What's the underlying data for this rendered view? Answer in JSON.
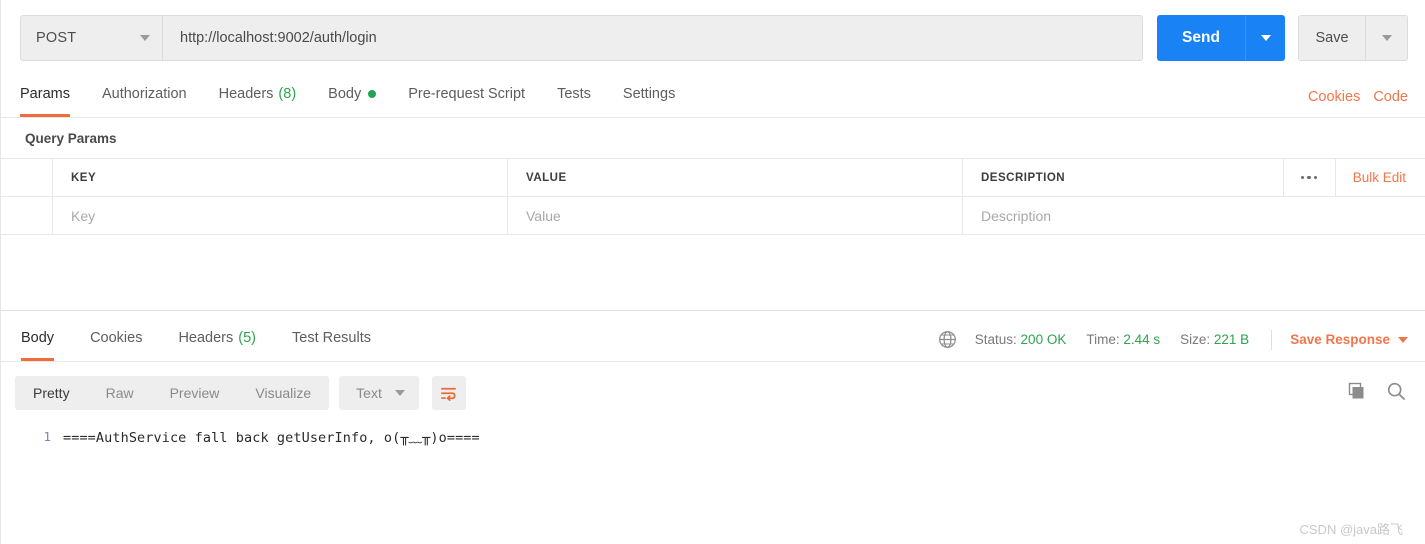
{
  "request": {
    "method": "POST",
    "url": "http://localhost:9002/auth/login",
    "send_label": "Send",
    "save_label": "Save"
  },
  "request_tabs": [
    {
      "label": "Params",
      "count": "",
      "active": true
    },
    {
      "label": "Authorization",
      "count": "",
      "active": false
    },
    {
      "label": "Headers",
      "count": "(8)",
      "active": false
    },
    {
      "label": "Body",
      "count": "",
      "active": false
    },
    {
      "label": "Pre-request Script",
      "count": "",
      "active": false
    },
    {
      "label": "Tests",
      "count": "",
      "active": false
    },
    {
      "label": "Settings",
      "count": "",
      "active": false
    }
  ],
  "request_tabs_right": {
    "cookies": "Cookies",
    "code": "Code"
  },
  "query_params": {
    "title": "Query Params",
    "headers": {
      "key": "KEY",
      "value": "VALUE",
      "description": "DESCRIPTION"
    },
    "bulk_edit": "Bulk Edit",
    "row": {
      "key_placeholder": "Key",
      "value_placeholder": "Value",
      "description_placeholder": "Description"
    }
  },
  "response_tabs": [
    {
      "label": "Body",
      "count": "",
      "active": true
    },
    {
      "label": "Cookies",
      "count": "",
      "active": false
    },
    {
      "label": "Headers",
      "count": "(5)",
      "active": false
    },
    {
      "label": "Test Results",
      "count": "",
      "active": false
    }
  ],
  "response_meta": {
    "status_label": "Status:",
    "status_value": "200 OK",
    "time_label": "Time:",
    "time_value": "2.44 s",
    "size_label": "Size:",
    "size_value": "221 B",
    "save_response": "Save Response"
  },
  "body_toolbar": {
    "segments": [
      {
        "label": "Pretty",
        "active": true
      },
      {
        "label": "Raw",
        "active": false
      },
      {
        "label": "Preview",
        "active": false
      },
      {
        "label": "Visualize",
        "active": false
      }
    ],
    "type": "Text"
  },
  "response_body": {
    "lines": [
      {
        "number": "1",
        "text": "====AuthService fall back getUserInfo, o(╥﹏╥)o===="
      }
    ]
  },
  "watermark": "CSDN @java路飞",
  "colors": {
    "accent_orange": "#f2764b",
    "send_blue": "#1982f5",
    "status_green": "#2ea44f",
    "panel_gray": "#eeeeee",
    "border_gray": "#e8e8e8"
  }
}
